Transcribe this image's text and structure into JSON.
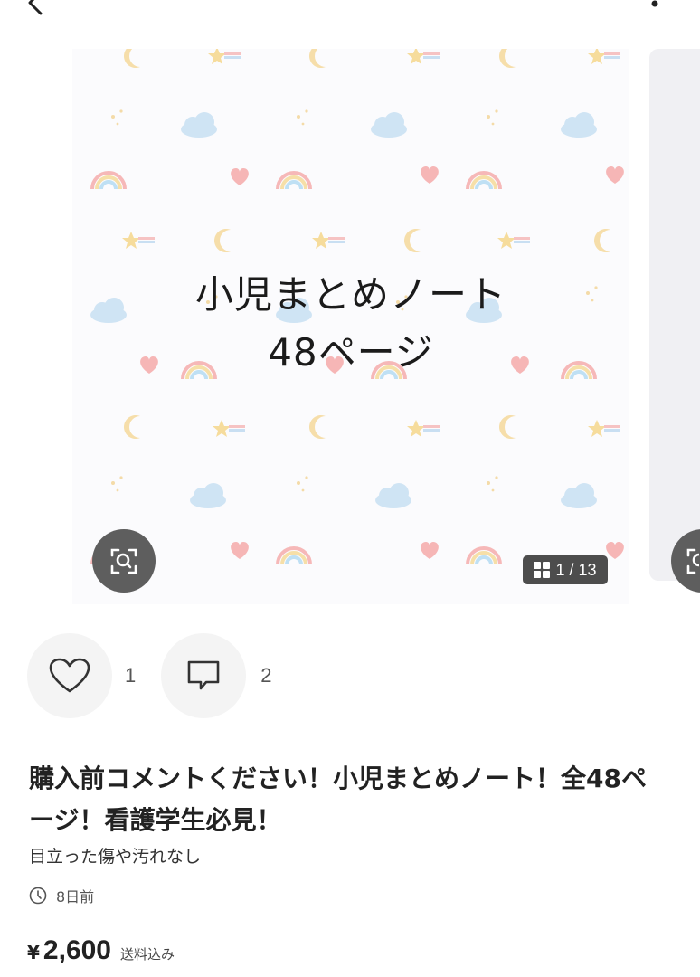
{
  "icons": {
    "back": "back-chevron-icon",
    "more": "more-dots-icon",
    "zoom": "image-search-icon",
    "gallery": "grid-icon",
    "like": "heart-icon",
    "comment": "comment-bubble-icon",
    "time": "clock-icon"
  },
  "carousel": {
    "caption_line1": "小児まとめノート",
    "caption_line2": "48ページ",
    "page_indicator": "1 / 13"
  },
  "reactions": {
    "like_count": "1",
    "comment_count": "2"
  },
  "item": {
    "title": "購入前コメントください！小児まとめノート！全48ページ！看護学生必見！",
    "condition": "目立った傷や汚れなし",
    "posted": "8日前",
    "price_symbol": "¥",
    "price": "2,600",
    "shipping": "送料込み"
  },
  "colors": {
    "text": "#222222",
    "overlay_dark": "#5e5e5e",
    "indicator_bg": "#4d4d4d",
    "reaction_bg": "#f4f4f4"
  }
}
